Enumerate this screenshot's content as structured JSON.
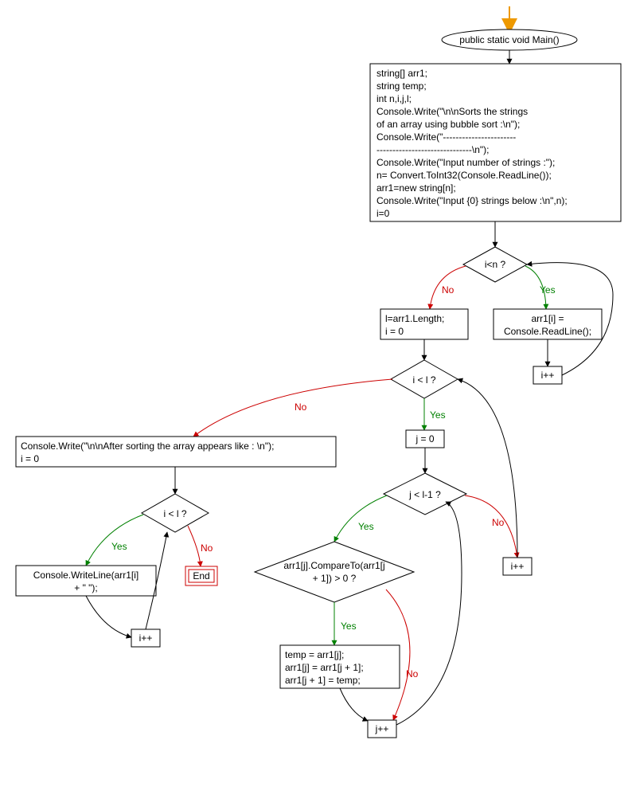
{
  "chart_data": {
    "type": "flowchart",
    "edge_labels": {
      "yes": "Yes",
      "no": "No"
    },
    "nodes": {
      "entry": {
        "kind": "arrow-entry"
      },
      "start": {
        "kind": "terminator",
        "text": "public static void Main()"
      },
      "init": {
        "kind": "process",
        "lines": [
          "string[] arr1;",
          "string temp;",
          "int n,i,j,l;",
          "Console.Write(\"\\n\\nSorts the strings",
          "of an array using bubble sort :\\n\");",
          "Console.Write(\"-----------------------",
          "------------------------------\\n\");",
          "Console.Write(\"Input number of strings :\");",
          "n= Convert.ToInt32(Console.ReadLine());",
          "arr1=new string[n];",
          "Console.Write(\"Input {0} strings below :\\n\",n);",
          "i=0"
        ]
      },
      "cond_i_lt_n": {
        "kind": "decision",
        "text": "i<n ?"
      },
      "read_line": {
        "kind": "process",
        "lines": [
          "arr1[i] =",
          "Console.ReadLine();"
        ]
      },
      "inc_i_1": {
        "kind": "process",
        "lines": [
          "i++"
        ]
      },
      "set_l": {
        "kind": "process",
        "lines": [
          "l=arr1.Length;",
          "i = 0"
        ]
      },
      "cond_i_lt_l": {
        "kind": "decision",
        "text": "i < l ?"
      },
      "set_j0": {
        "kind": "process",
        "lines": [
          "j = 0"
        ]
      },
      "cond_j_lt_lm1": {
        "kind": "decision",
        "text": "j < l-1 ?"
      },
      "cond_compare": {
        "kind": "decision",
        "lines": [
          "arr1[j].CompareTo(arr1[j",
          "+ 1]) > 0 ?"
        ]
      },
      "swap": {
        "kind": "process",
        "lines": [
          "temp = arr1[j];",
          "arr1[j] = arr1[j + 1];",
          "arr1[j + 1] = temp;"
        ]
      },
      "inc_j": {
        "kind": "process",
        "lines": [
          "j++"
        ]
      },
      "inc_i_2": {
        "kind": "process",
        "lines": [
          "i++"
        ]
      },
      "after_sort": {
        "kind": "process",
        "lines": [
          "Console.Write(\"\\n\\nAfter sorting the array appears like : \\n\");",
          "i = 0"
        ]
      },
      "cond_i_lt_l_2": {
        "kind": "decision",
        "text": "i < l ?"
      },
      "write_item": {
        "kind": "process",
        "lines": [
          "Console.WriteLine(arr1[i]",
          "+ \" \");"
        ]
      },
      "inc_i_3": {
        "kind": "process",
        "lines": [
          "i++"
        ]
      },
      "end": {
        "kind": "end",
        "text": "End"
      }
    },
    "edges": [
      {
        "from": "entry",
        "to": "start"
      },
      {
        "from": "start",
        "to": "init"
      },
      {
        "from": "init",
        "to": "cond_i_lt_n"
      },
      {
        "from": "cond_i_lt_n",
        "to": "read_line",
        "label": "yes"
      },
      {
        "from": "read_line",
        "to": "inc_i_1"
      },
      {
        "from": "inc_i_1",
        "to": "cond_i_lt_n"
      },
      {
        "from": "cond_i_lt_n",
        "to": "set_l",
        "label": "no"
      },
      {
        "from": "set_l",
        "to": "cond_i_lt_l"
      },
      {
        "from": "cond_i_lt_l",
        "to": "set_j0",
        "label": "yes"
      },
      {
        "from": "set_j0",
        "to": "cond_j_lt_lm1"
      },
      {
        "from": "cond_j_lt_lm1",
        "to": "cond_compare",
        "label": "yes"
      },
      {
        "from": "cond_compare",
        "to": "swap",
        "label": "yes"
      },
      {
        "from": "swap",
        "to": "inc_j"
      },
      {
        "from": "cond_compare",
        "to": "inc_j",
        "label": "no"
      },
      {
        "from": "inc_j",
        "to": "cond_j_lt_lm1"
      },
      {
        "from": "cond_j_lt_lm1",
        "to": "inc_i_2",
        "label": "no"
      },
      {
        "from": "inc_i_2",
        "to": "cond_i_lt_l"
      },
      {
        "from": "cond_i_lt_l",
        "to": "after_sort",
        "label": "no"
      },
      {
        "from": "after_sort",
        "to": "cond_i_lt_l_2"
      },
      {
        "from": "cond_i_lt_l_2",
        "to": "write_item",
        "label": "yes"
      },
      {
        "from": "write_item",
        "to": "inc_i_3"
      },
      {
        "from": "inc_i_3",
        "to": "cond_i_lt_l_2"
      },
      {
        "from": "cond_i_lt_l_2",
        "to": "end",
        "label": "no"
      }
    ]
  }
}
